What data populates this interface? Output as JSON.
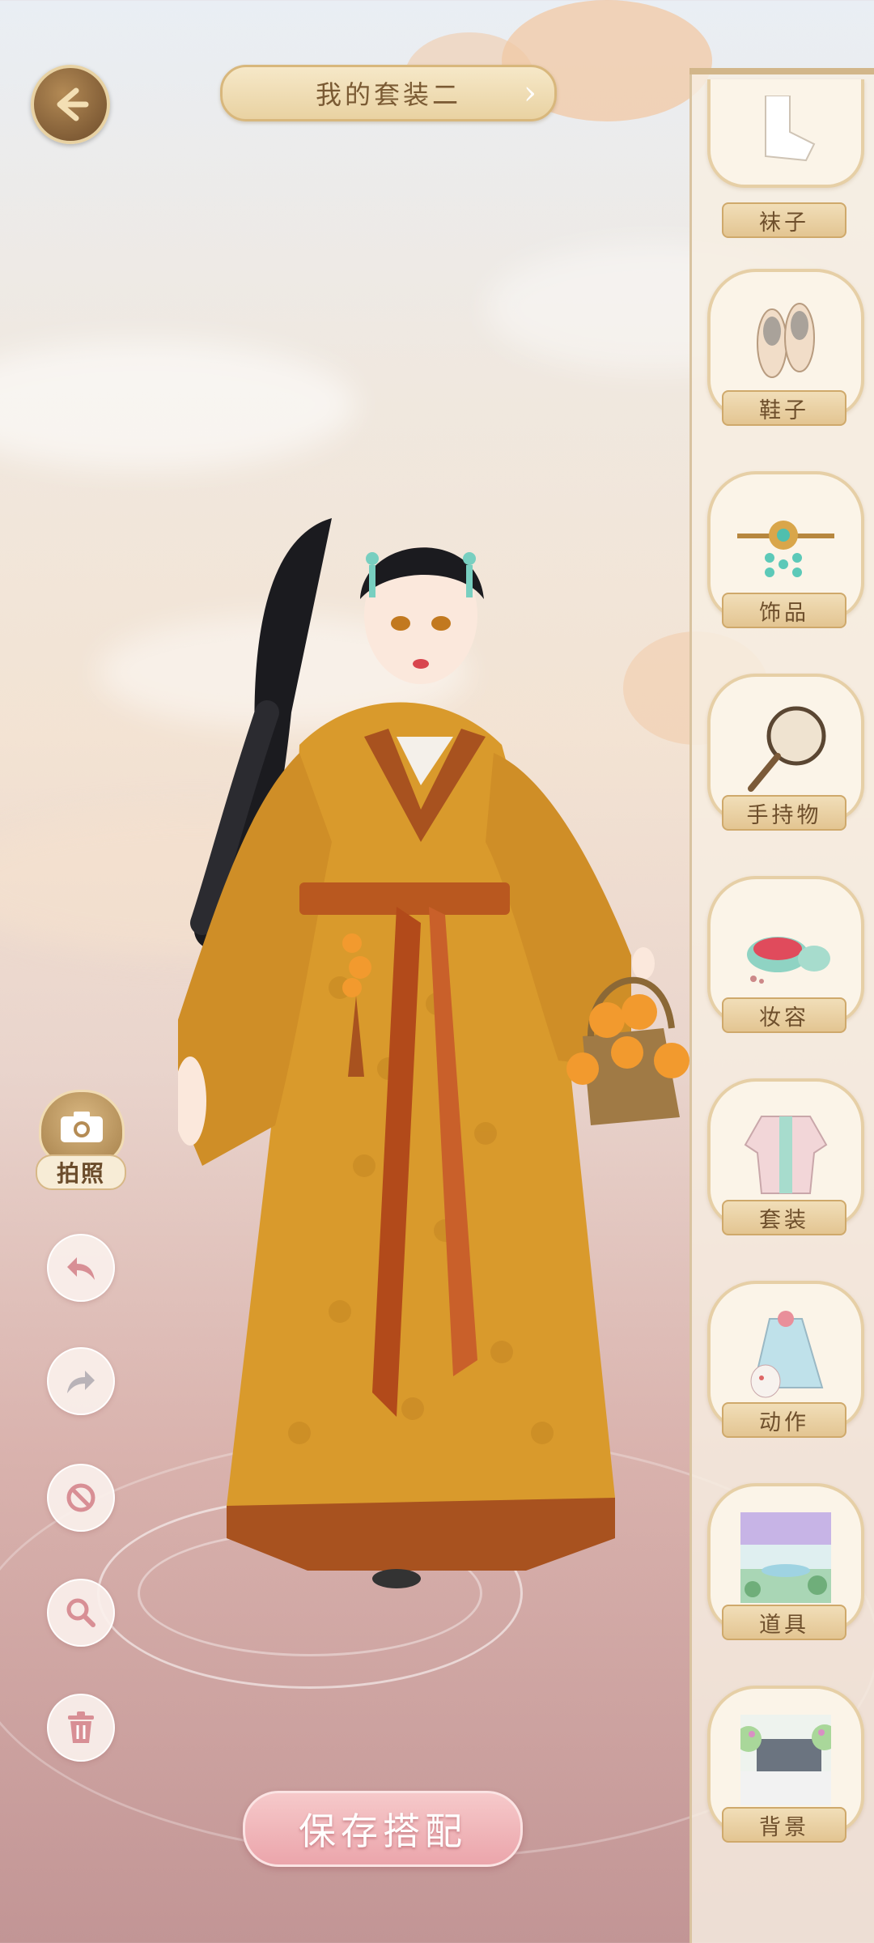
{
  "header": {
    "title": "我的套装二"
  },
  "categories": [
    {
      "label": "袜子",
      "icon": "socks-icon"
    },
    {
      "label": "鞋子",
      "icon": "shoes-icon"
    },
    {
      "label": "饰品",
      "icon": "hairpin-icon"
    },
    {
      "label": "手持物",
      "icon": "fan-icon"
    },
    {
      "label": "妆容",
      "icon": "makeup-icon"
    },
    {
      "label": "套装",
      "icon": "outfit-icon"
    },
    {
      "label": "动作",
      "icon": "pose-icon"
    },
    {
      "label": "道具",
      "icon": "prop-icon"
    },
    {
      "label": "背景",
      "icon": "background-icon"
    }
  ],
  "tools": {
    "photo_label": "拍照"
  },
  "footer": {
    "save_label": "保存搭配"
  },
  "colors": {
    "accent_gold": "#e3c592",
    "save_pink": "#eba5ab",
    "panel_border": "#d9c3a0"
  }
}
